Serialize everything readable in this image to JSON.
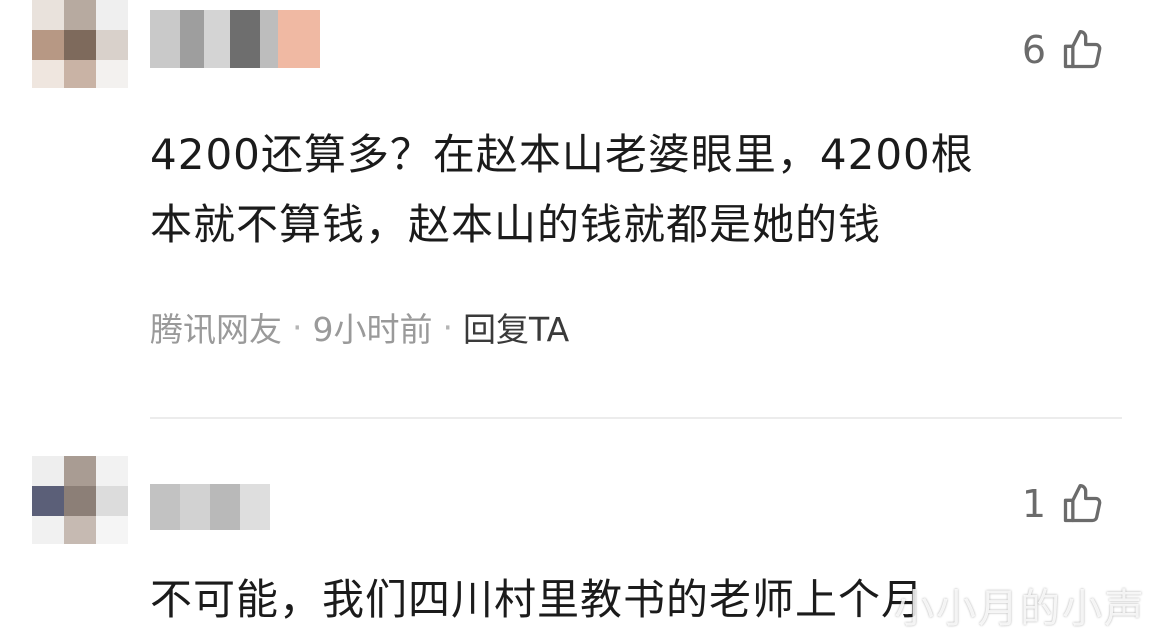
{
  "comments": [
    {
      "likes": "6",
      "text": "4200还算多？在赵本山老婆眼里，4200根\n本就不算钱，赵本山的钱就都是她的钱",
      "source": "腾讯网友",
      "time": "9小时前",
      "reply_label": "回复TA"
    },
    {
      "likes": "1",
      "text": "不可能，我们四川村里教书的老师上个月"
    }
  ],
  "meta_separator": "·",
  "watermark_text": "小小月的小声",
  "colors": {
    "text": "#1b1b1b",
    "meta": "#9a9a9a",
    "like": "#6b6b6b",
    "divider": "#ececec"
  },
  "icons": {
    "like": "thumbs-up-icon"
  }
}
